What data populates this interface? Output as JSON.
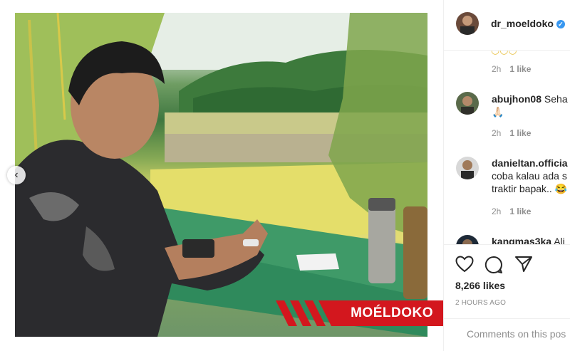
{
  "post": {
    "brand_overlay_text": "MOÉLDOKO",
    "prev_arrow_glyph": "‹"
  },
  "header": {
    "username": "dr_moeldoko",
    "verified_glyph": "✓"
  },
  "comments": [
    {
      "username": "",
      "text": "",
      "time": "2h",
      "likes": "1 like"
    },
    {
      "username": "abujhon08",
      "text": "Seha",
      "emoji_line": "🙏🏻",
      "time": "2h",
      "likes": "1 like"
    },
    {
      "username": "danieltan.officia",
      "text_line2": "coba kalau ada s",
      "text_line3": "traktir bapak.. 😂",
      "time": "2h",
      "likes": "1 like"
    },
    {
      "username": "kangmas3ka",
      "text": "Ali"
    }
  ],
  "actions": {
    "like_icon": "heart-icon",
    "comment_icon": "comment-icon",
    "share_icon": "share-icon",
    "likes_count": "8,266 likes",
    "time_ago": "2 HOURS AGO"
  },
  "add_comment": {
    "placeholder": "Comments on this pos"
  },
  "colors": {
    "brand_red": "#d3171e",
    "verified_blue": "#3897f0",
    "muted": "#8e8e8e"
  }
}
